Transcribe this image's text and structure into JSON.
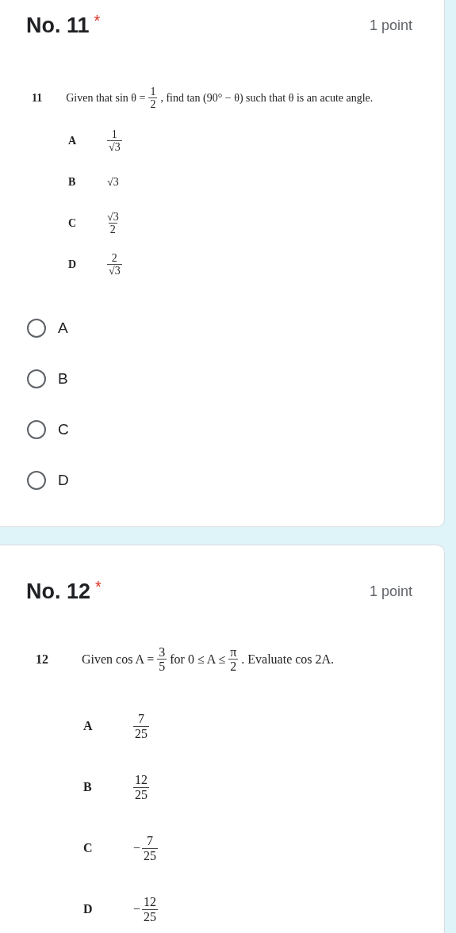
{
  "questions": [
    {
      "title": "No. 11",
      "required_mark": "*",
      "points": "1 point",
      "number": "11",
      "statement": [
        {
          "kind": "text",
          "text": "Given that sin θ ="
        },
        {
          "kind": "frac",
          "num": "1",
          "den": "2"
        },
        {
          "kind": "text",
          "text": ", find tan (90° − θ) such that θ is an acute angle."
        }
      ],
      "options": [
        {
          "letter": "A",
          "value": [
            {
              "kind": "frac",
              "num": "1",
              "den": "√3"
            }
          ]
        },
        {
          "letter": "B",
          "value": [
            {
              "kind": "text",
              "text": "√3"
            }
          ]
        },
        {
          "letter": "C",
          "value": [
            {
              "kind": "frac",
              "num": "√3",
              "den": "2"
            }
          ]
        },
        {
          "letter": "D",
          "value": [
            {
              "kind": "frac",
              "num": "2",
              "den": "√3"
            }
          ]
        }
      ],
      "choices": [
        {
          "label": "A",
          "selected": false
        },
        {
          "label": "B",
          "selected": false
        },
        {
          "label": "C",
          "selected": false
        },
        {
          "label": "D",
          "selected": false
        }
      ]
    },
    {
      "title": "No. 12",
      "required_mark": "*",
      "points": "1 point",
      "number": "12",
      "statement": [
        {
          "kind": "text",
          "text": "Given cos A ="
        },
        {
          "kind": "frac",
          "num": "3",
          "den": "5"
        },
        {
          "kind": "text",
          "text": "for 0 ≤ A ≤"
        },
        {
          "kind": "frac",
          "num": "π",
          "den": "2"
        },
        {
          "kind": "text",
          "text": ". Evaluate cos 2A."
        }
      ],
      "options": [
        {
          "letter": "A",
          "value": [
            {
              "kind": "frac",
              "num": "7",
              "den": "25"
            }
          ]
        },
        {
          "letter": "B",
          "value": [
            {
              "kind": "frac",
              "num": "12",
              "den": "25"
            }
          ]
        },
        {
          "letter": "C",
          "value": [
            {
              "kind": "text",
              "text": "−"
            },
            {
              "kind": "frac",
              "num": "7",
              "den": "25"
            }
          ]
        },
        {
          "letter": "D",
          "value": [
            {
              "kind": "text",
              "text": "−"
            },
            {
              "kind": "frac",
              "num": "12",
              "den": "25"
            }
          ]
        }
      ]
    }
  ]
}
